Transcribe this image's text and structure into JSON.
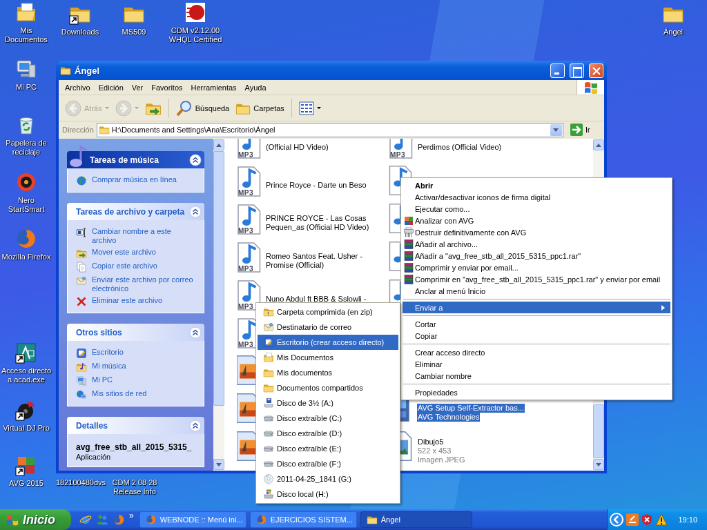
{
  "desktop_icons": [
    {
      "label": "Mis Documentos",
      "kind": "mydocs",
      "shortcut": false
    },
    {
      "label": "Downloads",
      "kind": "folder",
      "shortcut": true
    },
    {
      "label": "MS509",
      "kind": "folder",
      "shortcut": false
    },
    {
      "label": "CDM v2.12.00 WHQL Certified",
      "kind": "cdm",
      "shortcut": false
    },
    {
      "label": "Ángel",
      "kind": "folder",
      "shortcut": false
    },
    {
      "label": "Mi PC",
      "kind": "computer",
      "shortcut": false
    },
    {
      "label": "Papelera de reciclaje",
      "kind": "recycle",
      "shortcut": false
    },
    {
      "label": "Nero StartSmart",
      "kind": "nero",
      "shortcut": false
    },
    {
      "label": "Mozilla Firefox",
      "kind": "firefox",
      "shortcut": false
    },
    {
      "label": "Acceso directo a acad.exe",
      "kind": "acad",
      "shortcut": true
    },
    {
      "label": "Virtual DJ Pro",
      "kind": "vdj",
      "shortcut": true
    },
    {
      "label": "AVG 2015",
      "kind": "avg",
      "shortcut": true
    },
    {
      "label": "182100480dvs"
    },
    {
      "label": "CDM 2 08 28 Release Info"
    }
  ],
  "window": {
    "title": "Ángel",
    "menu": [
      "Archivo",
      "Edición",
      "Ver",
      "Favoritos",
      "Herramientas",
      "Ayuda"
    ],
    "toolbar": [
      {
        "kind": "back",
        "label": "Atrás",
        "disabled": true
      },
      {
        "kind": "forward",
        "disabled": true
      },
      {
        "kind": "up",
        "disabled": false
      },
      {
        "kind": "search",
        "label": "Búsqueda",
        "disabled": false
      },
      {
        "kind": "folders",
        "label": "Carpetas",
        "disabled": false
      },
      {
        "kind": "views",
        "disabled": false
      }
    ],
    "address": {
      "label": "Dirección",
      "value": "H:\\Documents and Settings\\Ana\\Escritorio\\Ángel",
      "go": "Ir"
    },
    "task_panels": [
      {
        "kind": "special",
        "title": "Tareas de música",
        "expanded": true,
        "items": [
          {
            "label": "Comprar música en línea",
            "kind": "globe"
          }
        ]
      },
      {
        "kind": "normal",
        "title": "Tareas de archivo y carpeta",
        "expanded": true,
        "items": [
          {
            "label": "Cambiar nombre a este archivo",
            "kind": "rename"
          },
          {
            "label": "Mover este archivo",
            "kind": "move"
          },
          {
            "label": "Copiar este archivo",
            "kind": "copy"
          },
          {
            "label": "Enviar este archivo por correo electrónico",
            "kind": "mail"
          },
          {
            "label": "Eliminar este archivo",
            "kind": "delete"
          }
        ]
      },
      {
        "kind": "normal",
        "title": "Otros sitios",
        "expanded": true,
        "items": [
          {
            "label": "Escritorio",
            "kind": "desktop"
          },
          {
            "label": "Mi música",
            "kind": "musicfolder"
          },
          {
            "label": "Mi PC",
            "kind": "computer"
          },
          {
            "label": "Mis sitios de red",
            "kind": "network"
          }
        ]
      },
      {
        "kind": "details",
        "title": "Detalles",
        "expanded": true,
        "name": "avg_free_stb_all_2015_5315_",
        "type": "Aplicación"
      }
    ],
    "rows": [
      {
        "tiles": [
          {
            "kind": "mp3",
            "badge": "MP3",
            "name": "(Official HD Video)",
            "selected": false
          },
          {
            "kind": "mp3",
            "badge": "MP3",
            "name": "Perdimos (Official Video)",
            "selected": false
          }
        ]
      },
      {
        "tiles": [
          {
            "kind": "mp3",
            "badge": "MP3",
            "name": "Prince Royce - Darte un Beso",
            "selected": false
          },
          {
            "kind": "mp3",
            "selected": false
          }
        ]
      },
      {
        "tiles": [
          {
            "kind": "mp3",
            "badge": "MP3",
            "name": "PRINCE ROYCE -  Las Cosas Pequen_as (Official HD Video)",
            "selected": false
          },
          {
            "kind": "mp3",
            "selected": false
          }
        ]
      },
      {
        "tiles": [
          {
            "kind": "mp3",
            "badge": "MP3",
            "name": "Romeo Santos Feat. Usher - Promise (Official)",
            "selected": false
          },
          {
            "kind": "mp3",
            "selected": false
          }
        ]
      },
      {
        "tiles": [
          {
            "kind": "mp3",
            "badge": "MP3",
            "name": "Nuno Abdul ft BBB & Sslowli -",
            "selected": false
          },
          {
            "kind": "mp3",
            "selected": false
          }
        ]
      },
      {
        "tiles": [
          {
            "kind": "mp3",
            "badge": "MP3",
            "selected": false
          }
        ]
      },
      {
        "tiles": [
          {
            "kind": "image",
            "selected": false
          }
        ]
      },
      {
        "tiles": [
          {
            "kind": "image",
            "selected": false
          },
          {
            "kind": "installer",
            "details": [
              "AVG Setup Self-Extractor bas...",
              "AVG Technologies"
            ],
            "selected": true
          }
        ]
      },
      {
        "tiles": [
          {
            "kind": "image",
            "selected": false
          },
          {
            "kind": "jpeg",
            "name": "Dibujo5",
            "details": [
              "522 x 453",
              "Imagen JPEG"
            ],
            "selected": false
          }
        ]
      }
    ]
  },
  "context_menu": [
    {
      "kind": "plain",
      "label": "Abrir",
      "default": true,
      "selected": false,
      "submenu": false
    },
    {
      "kind": "plain",
      "label": "Activar/desactivar iconos de firma digital",
      "default": false,
      "selected": false,
      "submenu": false
    },
    {
      "kind": "plain",
      "label": "Ejecutar como...",
      "default": false,
      "selected": false,
      "submenu": false
    },
    {
      "kind": "avg",
      "label": "Analizar con AVG",
      "default": false,
      "selected": false,
      "submenu": false
    },
    {
      "kind": "shredder",
      "label": "Destruir definitivamente con AVG",
      "default": false,
      "selected": false,
      "submenu": false
    },
    {
      "kind": "rar",
      "label": "Añadir al archivo...",
      "default": false,
      "selected": false,
      "submenu": false
    },
    {
      "kind": "rar",
      "label": "Añadir a \"avg_free_stb_all_2015_5315_ppc1.rar\"",
      "default": false,
      "selected": false,
      "submenu": false
    },
    {
      "kind": "rar",
      "label": "Comprimir y enviar por email...",
      "default": false,
      "selected": false,
      "submenu": false
    },
    {
      "kind": "rar",
      "label": "Comprimir en \"avg_free_stb_all_2015_5315_ppc1.rar\" y enviar por email",
      "default": false,
      "selected": false,
      "submenu": false
    },
    {
      "kind": "plain",
      "label": "Anclar al menú Inicio",
      "default": false,
      "selected": false,
      "submenu": false
    },
    {
      "kind": "separator"
    },
    {
      "kind": "plain",
      "label": "Enviar a",
      "default": false,
      "selected": true,
      "submenu": true
    },
    {
      "kind": "separator"
    },
    {
      "kind": "plain",
      "label": "Cortar",
      "default": false,
      "selected": false,
      "submenu": false
    },
    {
      "kind": "plain",
      "label": "Copiar",
      "default": false,
      "selected": false,
      "submenu": false
    },
    {
      "kind": "separator"
    },
    {
      "kind": "plain",
      "label": "Crear acceso directo",
      "default": false,
      "selected": false,
      "submenu": false
    },
    {
      "kind": "plain",
      "label": "Eliminar",
      "default": false,
      "selected": false,
      "submenu": false
    },
    {
      "kind": "plain",
      "label": "Cambiar nombre",
      "default": false,
      "selected": false,
      "submenu": false
    },
    {
      "kind": "separator"
    },
    {
      "kind": "plain",
      "label": "Propiedades",
      "default": false,
      "selected": false,
      "submenu": false
    }
  ],
  "send_to_menu": [
    {
      "kind": "zip",
      "label": "Carpeta comprimida (en zip)",
      "selected": false
    },
    {
      "kind": "mail",
      "label": "Destinatario de correo",
      "selected": false
    },
    {
      "kind": "desktop",
      "label": "Escritorio (crear acceso directo)",
      "selected": true
    },
    {
      "kind": "mydocs",
      "label": "Mis Documentos",
      "selected": false
    },
    {
      "kind": "folder",
      "label": "Mis documentos",
      "selected": false
    },
    {
      "kind": "folder",
      "label": "Documentos compartidos",
      "selected": false
    },
    {
      "kind": "floppy",
      "label": "Disco de 3½ (A:)",
      "selected": false
    },
    {
      "kind": "drive",
      "label": "Disco extraíble (C:)",
      "selected": false
    },
    {
      "kind": "drive",
      "label": "Disco extraíble (D:)",
      "selected": false
    },
    {
      "kind": "drive",
      "label": "Disco extraíble (E:)",
      "selected": false
    },
    {
      "kind": "drive",
      "label": "Disco extraíble (F:)",
      "selected": false
    },
    {
      "kind": "cd",
      "label": "2011-04-25_1841 (G:)",
      "selected": false
    },
    {
      "kind": "localdisk",
      "label": "Disco local (H:)",
      "selected": false
    }
  ],
  "taskbar": {
    "start": "Inicio",
    "quick_launch_more": "»",
    "tasks": [
      {
        "label": "WEBNODE :: Menú ini...",
        "kind": "firefox",
        "selected": false
      },
      {
        "label": "EJERCICIOS SISTEM...",
        "kind": "firefox",
        "selected": false
      },
      {
        "label": "Ángel",
        "kind": "folder",
        "selected": true
      }
    ],
    "clock": "19:10"
  }
}
